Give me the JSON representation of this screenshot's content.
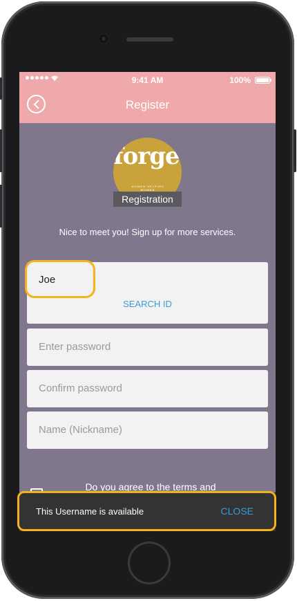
{
  "status_bar": {
    "time": "9:41 AM",
    "battery": "100%"
  },
  "header": {
    "title": "Register",
    "back_icon": "chevron-left-icon"
  },
  "logo": {
    "wordmark": "forge.",
    "tagline": "WOMEN HELPING WOMEN",
    "badge": "Registration"
  },
  "intro": "Nice to meet you! Sign up for more services.",
  "form": {
    "id_value": "Joe",
    "search_id_label": "SEARCH ID",
    "password_placeholder": "Enter password",
    "confirm_placeholder": "Confirm password",
    "name_placeholder": "Name (Nickname)"
  },
  "terms": {
    "text": "Do you agree to the terms and"
  },
  "snackbar": {
    "message": "This Username is available",
    "action": "CLOSE"
  },
  "colors": {
    "header": "#f0a9ab",
    "background": "#80778d",
    "accent_link": "#3a9bd9",
    "highlight": "#f4b21b",
    "logo": "#c9a23b"
  }
}
